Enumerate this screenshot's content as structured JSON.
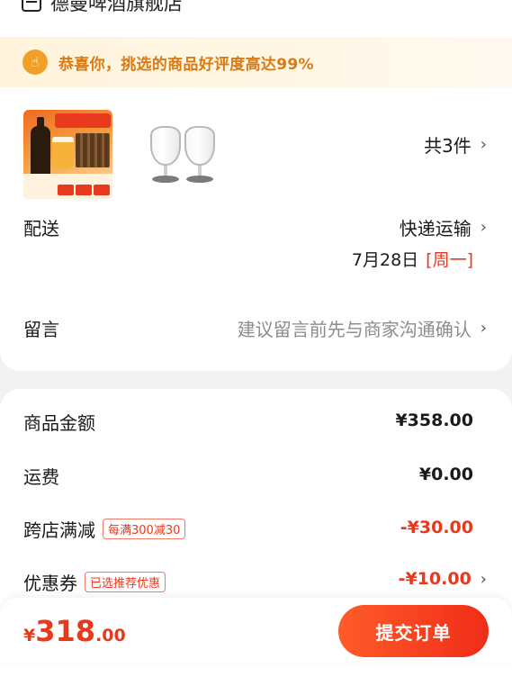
{
  "store": {
    "name": "德曼啤酒旗舰店",
    "icon": "store-icon"
  },
  "notice": {
    "text": "恭喜你，挑选的商品好评度高达99%",
    "icon": "thumbs-up-icon",
    "color": "#f0a028"
  },
  "order_items": {
    "count_label": "共3件",
    "items": [
      {
        "image": "beer-gift-box-image"
      },
      {
        "image": "whisky-glasses-image"
      }
    ]
  },
  "delivery": {
    "label": "配送",
    "method": "快递运输",
    "date": "7月28日",
    "weekday": "[周一]"
  },
  "message": {
    "label": "留言",
    "placeholder": "建议留言前先与商家沟通确认"
  },
  "summary": {
    "goods_label": "商品金额",
    "goods_value": "¥358.00",
    "shipping_label": "运费",
    "shipping_value": "¥0.00",
    "cross_label": "跨店满减",
    "cross_badge": "每满300减30",
    "cross_value": "-¥30.00",
    "coupon_label": "优惠券",
    "coupon_badge": "已选推荐优惠",
    "coupon_value": "-¥10.00"
  },
  "footer": {
    "currency": "¥",
    "total_int": "318",
    "total_dec": ".00",
    "submit_label": "提交订单"
  },
  "colors": {
    "accent_red": "#e8391c",
    "notice_text": "#d97a12"
  }
}
